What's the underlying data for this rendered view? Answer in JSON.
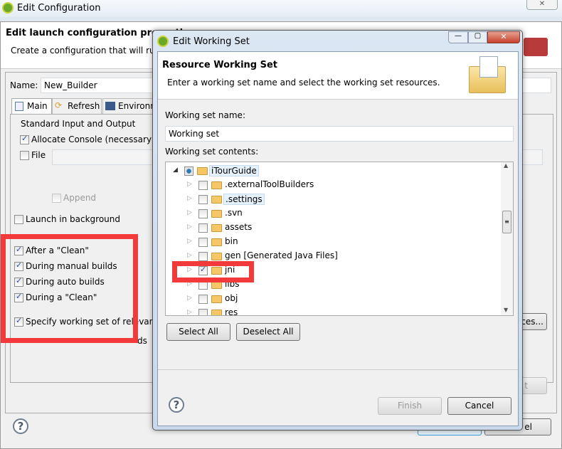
{
  "main_window": {
    "title": "Edit Configuration",
    "header_title": "Edit launch configuration properti",
    "header_desc": "Create a configuration that will run",
    "name_label": "Name:",
    "name_value": "New_Builder",
    "tabs": [
      {
        "label": "Main",
        "icon": "main-tab-icon"
      },
      {
        "label": "Refresh",
        "icon": "refresh-icon"
      },
      {
        "label": "Environm",
        "icon": "environment-icon"
      }
    ],
    "std_io_label": "Standard Input and Output",
    "allocate_console": {
      "label": "Allocate Console (necessary f",
      "checked": true
    },
    "file": {
      "label": "File",
      "checked": false
    },
    "append": {
      "label": "Append",
      "checked": false
    },
    "launch_background": {
      "label": "Launch in background",
      "checked": false
    },
    "run_options": [
      {
        "label": "After a \"Clean\"",
        "checked": true
      },
      {
        "label": "During manual builds",
        "checked": true
      },
      {
        "label": "During auto builds",
        "checked": true
      },
      {
        "label": "During a \"Clean\"",
        "checked": true
      }
    ],
    "specify_working_set": {
      "label": "Specify working set of relevant",
      "checked": true
    },
    "note_fragment": "ds",
    "resources_button": "ces...",
    "button_partial_t": "t",
    "cancel_partial": "el"
  },
  "dialog": {
    "title": "Edit Working Set",
    "header_title": "Resource Working Set",
    "header_desc": "Enter a working set name and select the working set resources.",
    "name_label": "Working set name:",
    "name_value": "Working set",
    "contents_label": "Working set contents:",
    "tree": [
      {
        "label": "iTourGuide",
        "level": 0,
        "expanded": true,
        "checked": "partial",
        "icon": "project-folder-icon"
      },
      {
        "label": ".externalToolBuilders",
        "level": 1,
        "checked": false,
        "icon": "folder-icon"
      },
      {
        "label": ".settings",
        "level": 1,
        "checked": false,
        "icon": "folder-icon"
      },
      {
        "label": ".svn",
        "level": 1,
        "checked": false,
        "icon": "folder-icon"
      },
      {
        "label": "assets",
        "level": 1,
        "checked": false,
        "icon": "source-folder-icon"
      },
      {
        "label": "bin",
        "level": 1,
        "checked": false,
        "icon": "source-folder-icon"
      },
      {
        "label": "gen [Generated Java Files]",
        "level": 1,
        "checked": false,
        "icon": "source-folder-icon"
      },
      {
        "label": "jni",
        "level": 1,
        "checked": true,
        "icon": "folder-icon"
      },
      {
        "label": "libs",
        "level": 1,
        "checked": false,
        "icon": "folder-icon"
      },
      {
        "label": "obj",
        "level": 1,
        "checked": false,
        "icon": "folder-icon"
      },
      {
        "label": "res",
        "level": 1,
        "checked": false,
        "icon": "source-folder-icon"
      }
    ],
    "select_all": "Select All",
    "deselect_all": "Deselect All",
    "finish": "Finish",
    "cancel": "Cancel"
  },
  "colors": {
    "highlight": "#f23a3a",
    "dialog_bg": "#f0f0f0"
  }
}
